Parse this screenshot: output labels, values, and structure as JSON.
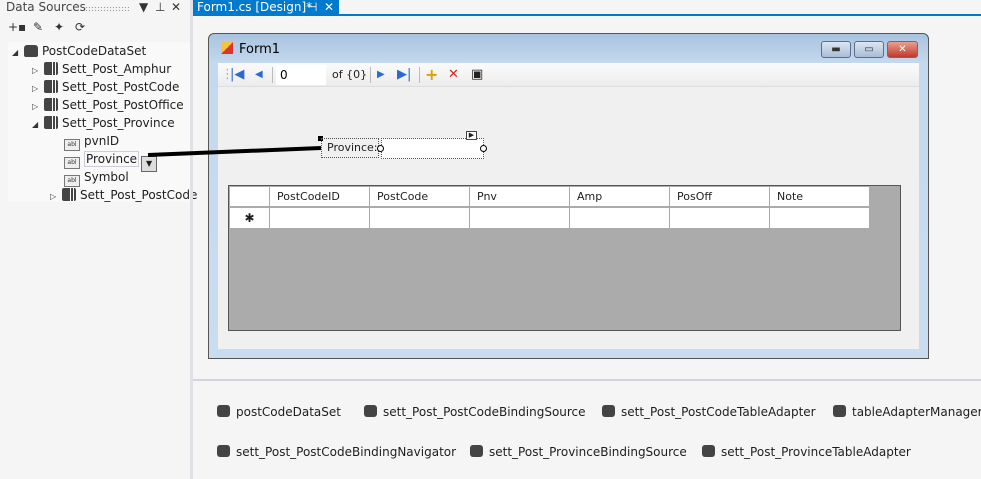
{
  "data_sources": {
    "title": "Data Sources",
    "dataset": "PostCodeDataSet",
    "tables": [
      "Sett_Post_Amphur",
      "Sett_Post_PostCode",
      "Sett_Post_PostOffice",
      "Sett_Post_Province"
    ],
    "fields": [
      "pvnID",
      "Province",
      "Symbol"
    ],
    "child_table": "Sett_Post_PostCode"
  },
  "tab": {
    "label": "Form1.cs [Design]*"
  },
  "form": {
    "title": "Form1",
    "navigator": {
      "position": "0",
      "count": "of {0}"
    },
    "province_label": "Province:",
    "grid_columns": [
      "PostCodeID",
      "PostCode",
      "Pnv",
      "Amp",
      "PosOff",
      "Note"
    ],
    "new_row_marker": "✱"
  },
  "tray": [
    "postCodeDataSet",
    "sett_Post_PostCodeBindingSource",
    "sett_Post_PostCodeTableAdapter",
    "tableAdapterManager",
    "sett_Post_PostCodeBindingNavigator",
    "sett_Post_ProvinceBindingSource",
    "sett_Post_ProvinceTableAdapter"
  ],
  "colors": {
    "accent": "#007acc",
    "grid_bg": "#ababab"
  }
}
